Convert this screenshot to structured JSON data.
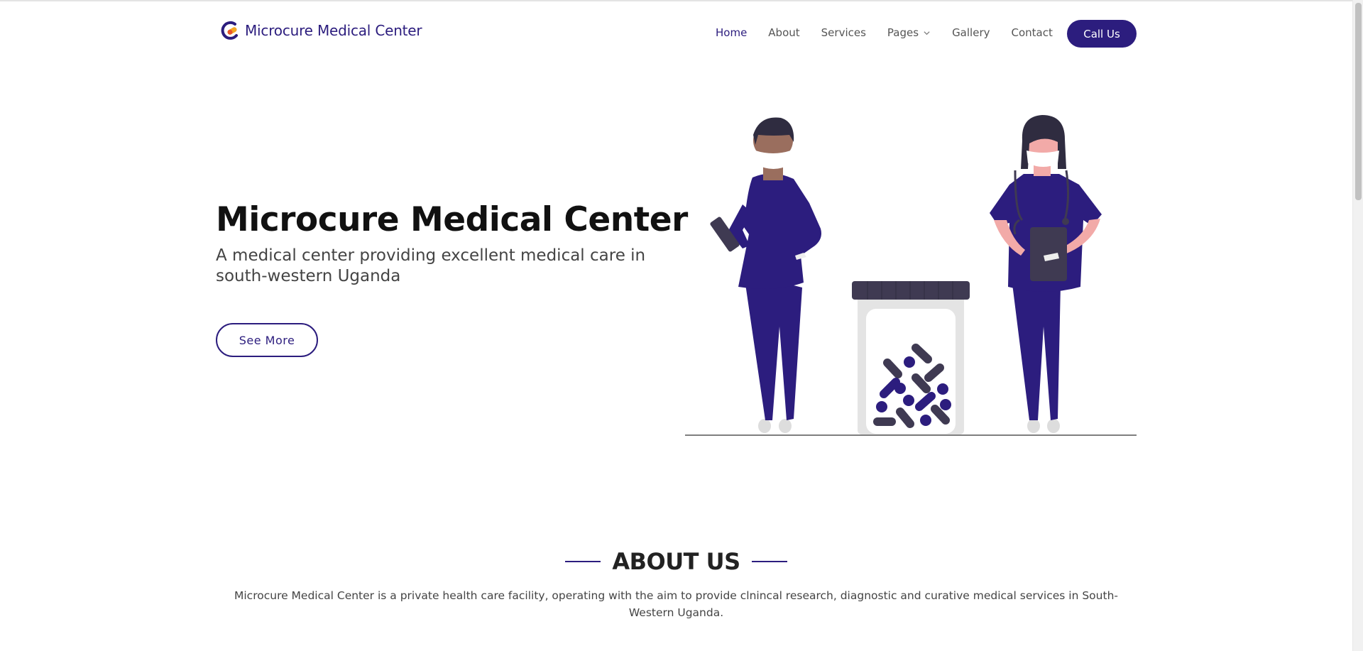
{
  "brand": {
    "name": "Microcure Medical Center",
    "primary_color": "#2c1d7e",
    "accent_color": "#f5a623"
  },
  "nav": {
    "items": [
      {
        "label": "Home",
        "active": true
      },
      {
        "label": "About"
      },
      {
        "label": "Services"
      },
      {
        "label": "Pages",
        "dropdown": true
      },
      {
        "label": "Gallery"
      },
      {
        "label": "Contact"
      }
    ],
    "cta_label": "Call Us"
  },
  "hero": {
    "title": "Microcure Medical Center",
    "subtitle": "A medical center providing excellent medical care in south-western Uganda",
    "button_label": "See More",
    "illustration": "two-masked-doctors-with-pill-jar"
  },
  "about": {
    "title": "ABOUT US",
    "text": "Microcure Medical Center is a private health care facility, operating with the aim to provide clnincal research, diagnostic and curative medical services in South-Western Uganda."
  }
}
